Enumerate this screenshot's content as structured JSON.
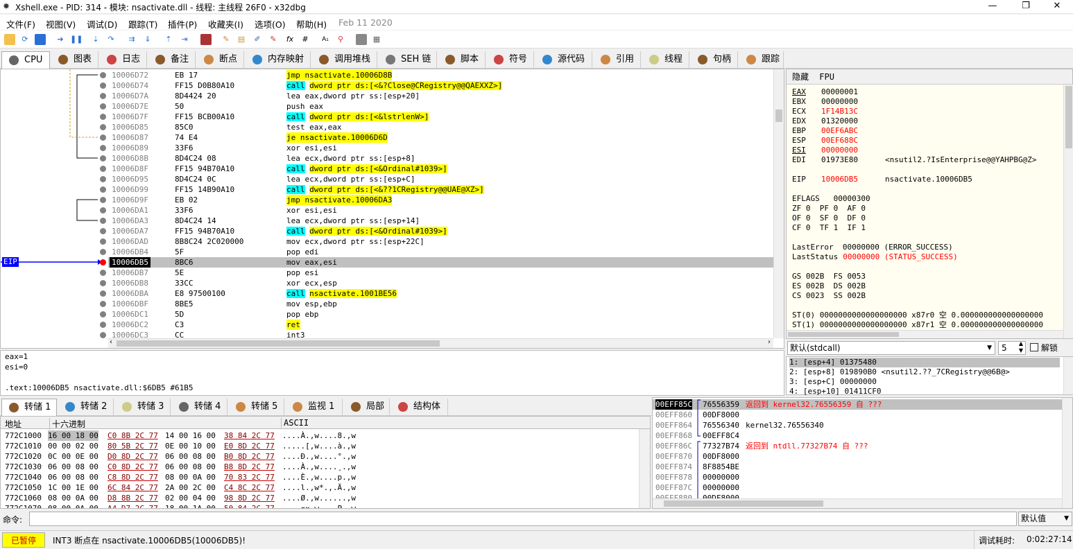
{
  "window": {
    "title": "Xshell.exe - PID: 314 - 模块: nsactivate.dll - 线程: 主线程 26F0 - x32dbg",
    "minimize": "—",
    "maximize": "❐",
    "close": "✕"
  },
  "menu": [
    "文件(F)",
    "视图(V)",
    "调试(D)",
    "跟踪(T)",
    "插件(P)",
    "收藏夹(I)",
    "选项(O)",
    "帮助(H)",
    "Feb 11 2020"
  ],
  "tabs": [
    "CPU",
    "图表",
    "日志",
    "备注",
    "断点",
    "内存映射",
    "调用堆栈",
    "SEH 链",
    "脚本",
    "符号",
    "源代码",
    "引用",
    "线程",
    "句柄",
    "跟踪"
  ],
  "eip_label": "EIP",
  "disasm": [
    {
      "addr": "10006D72",
      "bytes": "EB 17",
      "mn": "jmp",
      "op": "nsactivate.10006D8B",
      "hl": "jmp"
    },
    {
      "addr": "10006D74",
      "bytes": "FF15 D0B80A10",
      "mn": "call",
      "op": "dword ptr ds:[<&?Close@CRegistry@@QAEXXZ>]",
      "hl": "call"
    },
    {
      "addr": "10006D7A",
      "bytes": "8D4424 20",
      "mn": "lea",
      "op": "eax,dword ptr ss:[esp+20]"
    },
    {
      "addr": "10006D7E",
      "bytes": "50",
      "mn": "push",
      "op": "eax"
    },
    {
      "addr": "10006D7F",
      "bytes": "FF15 BCB00A10",
      "mn": "call",
      "op": "dword ptr ds:[<&lstrlenW>]",
      "hl": "call"
    },
    {
      "addr": "10006D85",
      "bytes": "85C0",
      "mn": "test",
      "op": "eax,eax"
    },
    {
      "addr": "10006D87",
      "bytes": "74 E4",
      "mn": "je",
      "op": "nsactivate.10006D6D",
      "hl": "jmp"
    },
    {
      "addr": "10006D89",
      "bytes": "33F6",
      "mn": "xor",
      "op": "esi,esi"
    },
    {
      "addr": "10006D8B",
      "bytes": "8D4C24 08",
      "mn": "lea",
      "op": "ecx,dword ptr ss:[esp+8]"
    },
    {
      "addr": "10006D8F",
      "bytes": "FF15 94B70A10",
      "mn": "call",
      "op": "dword ptr ds:[<&Ordinal#1039>]",
      "hl": "call"
    },
    {
      "addr": "10006D95",
      "bytes": "8D4C24 0C",
      "mn": "lea",
      "op": "ecx,dword ptr ss:[esp+C]"
    },
    {
      "addr": "10006D99",
      "bytes": "FF15 14B90A10",
      "mn": "call",
      "op": "dword ptr ds:[<&??1CRegistry@@UAE@XZ>]",
      "hl": "call"
    },
    {
      "addr": "10006D9F",
      "bytes": "EB 02",
      "mn": "jmp",
      "op": "nsactivate.10006DA3",
      "hl": "jmp"
    },
    {
      "addr": "10006DA1",
      "bytes": "33F6",
      "mn": "xor",
      "op": "esi,esi"
    },
    {
      "addr": "10006DA3",
      "bytes": "8D4C24 14",
      "mn": "lea",
      "op": "ecx,dword ptr ss:[esp+14]"
    },
    {
      "addr": "10006DA7",
      "bytes": "FF15 94B70A10",
      "mn": "call",
      "op": "dword ptr ds:[<&Ordinal#1039>]",
      "hl": "call"
    },
    {
      "addr": "10006DAD",
      "bytes": "8B8C24 2C020000",
      "mn": "mov",
      "op": "ecx,dword ptr ss:[esp+22C]"
    },
    {
      "addr": "10006DB4",
      "bytes": "5F",
      "mn": "pop",
      "op": "edi"
    },
    {
      "addr": "10006DB5",
      "bytes": "8BC6",
      "mn": "mov",
      "op": "eax,esi",
      "sel": true
    },
    {
      "addr": "10006DB7",
      "bytes": "5E",
      "mn": "pop",
      "op": "esi"
    },
    {
      "addr": "10006DB8",
      "bytes": "33CC",
      "mn": "xor",
      "op": "ecx,esp"
    },
    {
      "addr": "10006DBA",
      "bytes": "E8 97500100",
      "mn": "call",
      "op": "nsactivate.1001BE56",
      "hl": "call"
    },
    {
      "addr": "10006DBF",
      "bytes": "8BE5",
      "mn": "mov",
      "op": "esp,ebp"
    },
    {
      "addr": "10006DC1",
      "bytes": "5D",
      "mn": "pop",
      "op": "ebp"
    },
    {
      "addr": "10006DC2",
      "bytes": "C3",
      "mn": "ret",
      "op": "",
      "hl": "ret"
    },
    {
      "addr": "10006DC3",
      "bytes": "CC",
      "mn": "int3",
      "op": ""
    }
  ],
  "regs_header": [
    "隐藏",
    "FPU"
  ],
  "regs": [
    {
      "n": "EAX",
      "v": "00000001",
      "c": ""
    },
    {
      "n": "EBX",
      "v": "00000000",
      "c": ""
    },
    {
      "n": "ECX",
      "v": "1F14B13C",
      "c": "red"
    },
    {
      "n": "EDX",
      "v": "01320000",
      "c": ""
    },
    {
      "n": "EBP",
      "v": "00EF6ABC",
      "c": "red"
    },
    {
      "n": "ESP",
      "v": "00EF688C",
      "c": "red"
    },
    {
      "n": "ESI",
      "v": "00000000",
      "c": "red"
    },
    {
      "n": "EDI",
      "v": "01973E80",
      "c": "",
      "x": "<nsutil2.?IsEnterprise@@YAHPBG@Z>"
    }
  ],
  "eip_row": {
    "n": "EIP",
    "v": "10006DB5",
    "x": "nsactivate.10006DB5"
  },
  "flags": [
    "EFLAGS   00000300",
    "ZF 0  PF 0  AF 0",
    "OF 0  SF 0  DF 0",
    "CF 0  TF 1  IF 1"
  ],
  "lasterror": "LastError  00000000 (ERROR_SUCCESS)",
  "laststatus_label": "LastStatus",
  "laststatus_val": "00000000 (STATUS_SUCCESS)",
  "segs": [
    "GS 002B  FS 0053",
    "ES 002B  DS 002B",
    "CS 0023  SS 002B"
  ],
  "st": [
    "ST(0) 0000000000000000000 x87r0 空 0.000000000000000000",
    "ST(1) 0000000000000000000 x87r1 空 0.000000000000000000"
  ],
  "callconv": "默认(stdcall)",
  "argcount": "5",
  "unlock": "解锁",
  "args": [
    "1: [esp+4] 01375480",
    "2: [esp+8] 019890B0 <nsutil2.??_7CRegistry@@6B@>",
    "3: [esp+C] 00000000",
    "4: [esp+10] 01411CF0"
  ],
  "info": [
    "eax=1",
    "esi=0",
    "",
    ".text:10006DB5 nsactivate.dll:$6DB5 #61B5"
  ],
  "dumptabs": [
    "转储 1",
    "转储 2",
    "转储 3",
    "转储 4",
    "转储 5",
    "监视 1",
    "局部",
    "结构体"
  ],
  "dump_hdr": {
    "addr": "地址",
    "hex": "十六进制",
    "ascii": "ASCII"
  },
  "dump": [
    {
      "a": "772C1000",
      "h1": "16 00 18 00",
      "h2": "C0 8B 2C 77",
      "h3": "14 00 16 00",
      "h4": "38 84 2C 77",
      "s": "....À.,w....8.,w"
    },
    {
      "a": "772C1010",
      "h1": "00 00 02 00",
      "h2": "80 5B 2C 77",
      "h3": "0E 00 10 00",
      "h4": "E0 8D 2C 77",
      "s": ".....[,w....à.,w"
    },
    {
      "a": "772C1020",
      "h1": "0C 00 0E 00",
      "h2": "D0 8D 2C 77",
      "h3": "06 00 08 00",
      "h4": "B0 8D 2C 77",
      "s": "....Ð.,w....°.,w"
    },
    {
      "a": "772C1030",
      "h1": "06 00 08 00",
      "h2": "C0 8D 2C 77",
      "h3": "06 00 08 00",
      "h4": "B8 8D 2C 77",
      "s": "....À.,w....¸.,w"
    },
    {
      "a": "772C1040",
      "h1": "06 00 08 00",
      "h2": "C8 8D 2C 77",
      "h3": "08 00 0A 00",
      "h4": "70 83 2C 77",
      "s": "....È.,w....p.,w"
    },
    {
      "a": "772C1050",
      "h1": "1C 00 1E 00",
      "h2": "6C 84 2C 77",
      "h3": "2A 00 2C 00",
      "h4": "C4 8C 2C 77",
      "s": "....l.,w*.,.Ä.,w"
    },
    {
      "a": "772C1060",
      "h1": "08 00 0A 00",
      "h2": "D8 8B 2C 77",
      "h3": "02 00 04 00",
      "h4": "98 8D 2C 77",
      "s": "....Ø.,w......,w"
    },
    {
      "a": "772C1070",
      "h1": "08 00 0A 00",
      "h2": "A4 D7 2C 77",
      "h3": "18 00 1A 00",
      "h4": "50 84 2C 77",
      "s": "....¤×,w....P.,w"
    }
  ],
  "stack": [
    {
      "a": "00EFF85C",
      "v": "76556359",
      "c": "返回到 kernel32.76556359 自 ???",
      "red": true
    },
    {
      "a": "00EFF860",
      "v": "00DF8000",
      "c": ""
    },
    {
      "a": "00EFF864",
      "v": "76556340",
      "c": "kernel32.76556340"
    },
    {
      "a": "00EFF868",
      "v": "00EFF8C4",
      "c": ""
    },
    {
      "a": "00EFF86C",
      "v": "77327B74",
      "c": "返回到 ntdll.77327B74 自 ???",
      "red": true
    },
    {
      "a": "00EFF870",
      "v": "00DF8000",
      "c": ""
    },
    {
      "a": "00EFF874",
      "v": "8F8854BE",
      "c": ""
    },
    {
      "a": "00EFF878",
      "v": "00000000",
      "c": ""
    },
    {
      "a": "00EFF87C",
      "v": "00000000",
      "c": ""
    },
    {
      "a": "00EFF880",
      "v": "00DF8000",
      "c": ""
    }
  ],
  "cmd_label": "命令:",
  "cmd_default": "默认值",
  "status": {
    "state": "已暂停",
    "msg": "INT3 断点在 nsactivate.10006DB5(10006DB5)!",
    "time_label": "调试耗时:",
    "time": "0:02:27:14"
  },
  "colors": {
    "accent": "#0000ff",
    "highlight_yellow": "#ffff00",
    "highlight_cyan": "#00ffff",
    "paused": "#ffff00",
    "eip_bp": "#ff0000"
  }
}
